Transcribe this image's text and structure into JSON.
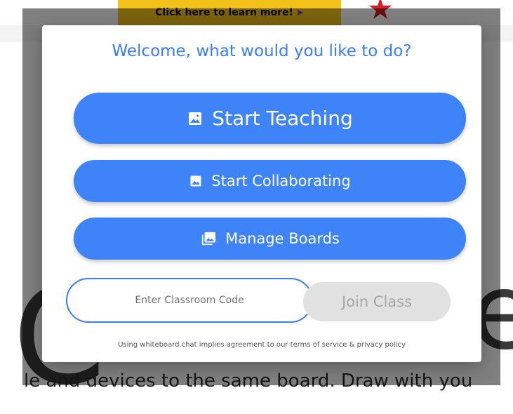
{
  "background": {
    "banner_text": "Click here to learn more!",
    "big_letter_left": "C",
    "big_letter_right": "e",
    "bottom_text": "le and devices to the same board. Draw with you"
  },
  "dialog": {
    "title": "Welcome, what would you like to do?",
    "buttons": {
      "start_teaching": "Start Teaching",
      "start_collaborating": "Start Collaborating",
      "manage_boards": "Manage Boards"
    },
    "classroom_code": {
      "placeholder": "Enter Classroom Code",
      "value": ""
    },
    "join_label": "Join Class",
    "footer": "Using whiteboard.chat implies agreement to our terms of service & privacy policy"
  },
  "icons": {
    "start_teaching": "image-icon",
    "start_collaborating": "image-icon",
    "manage_boards": "photo-library-icon",
    "banner_cursor": "cursor-icon"
  },
  "colors": {
    "accent": "#3f83f8",
    "title": "#3a7cf5",
    "join_disabled_bg": "#e1e1e1",
    "banner_bg": "#f2c21a"
  }
}
